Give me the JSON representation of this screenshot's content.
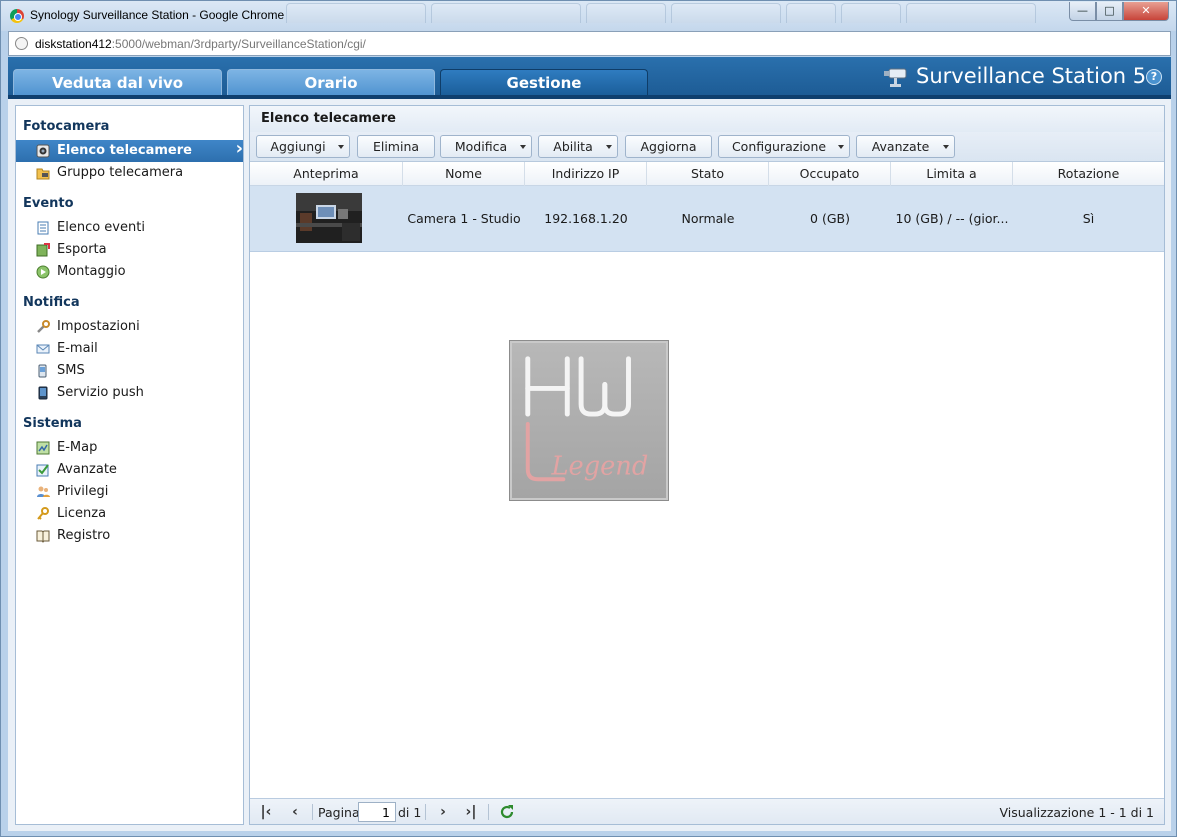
{
  "browser": {
    "window_title": "Synology Surveillance Station - Google Chrome",
    "url_host": "diskstation412",
    "url_path": ":5000/webman/3rdparty/SurveillanceStation/cgi/",
    "controls": {
      "minimize": "—",
      "maximize": "□",
      "close": "✕"
    }
  },
  "app": {
    "brand": "Surveillance Station 5",
    "help": "?",
    "tabs": [
      {
        "label": "Veduta dal vivo",
        "active": false
      },
      {
        "label": "Orario",
        "active": false
      },
      {
        "label": "Gestione",
        "active": true
      }
    ]
  },
  "sidebar": {
    "sections": [
      {
        "title": "Fotocamera",
        "items": [
          {
            "label": "Elenco telecamere",
            "icon": "camera-icon",
            "selected": true
          },
          {
            "label": "Gruppo telecamera",
            "icon": "folder-camera-icon",
            "selected": false
          }
        ]
      },
      {
        "title": "Evento",
        "items": [
          {
            "label": "Elenco eventi",
            "icon": "event-list-icon"
          },
          {
            "label": "Esporta",
            "icon": "export-icon"
          },
          {
            "label": "Montaggio",
            "icon": "montage-icon"
          }
        ]
      },
      {
        "title": "Notifica",
        "items": [
          {
            "label": "Impostazioni",
            "icon": "wrench-icon"
          },
          {
            "label": "E-mail",
            "icon": "envelope-icon"
          },
          {
            "label": "SMS",
            "icon": "sms-icon"
          },
          {
            "label": "Servizio push",
            "icon": "mobile-icon"
          }
        ]
      },
      {
        "title": "Sistema",
        "items": [
          {
            "label": "E-Map",
            "icon": "map-icon"
          },
          {
            "label": "Avanzate",
            "icon": "advanced-icon"
          },
          {
            "label": "Privilegi",
            "icon": "users-icon"
          },
          {
            "label": "Licenza",
            "icon": "key-icon"
          },
          {
            "label": "Registro",
            "icon": "book-icon"
          }
        ]
      }
    ]
  },
  "panel": {
    "title": "Elenco telecamere",
    "toolbar": [
      {
        "label": "Aggiungi",
        "dropdown": true
      },
      {
        "label": "Elimina",
        "dropdown": false
      },
      {
        "label": "Modifica",
        "dropdown": true
      },
      {
        "label": "Abilita",
        "dropdown": true
      },
      {
        "label": "Aggiorna",
        "dropdown": false
      },
      {
        "label": "Configurazione",
        "dropdown": true
      },
      {
        "label": "Avanzate",
        "dropdown": true
      }
    ],
    "columns": [
      "Anteprima",
      "Nome",
      "Indirizzo IP",
      "Stato",
      "Occupato",
      "Limita a",
      "Rotazione"
    ],
    "rows": [
      {
        "name": "Camera 1 - Studio",
        "ip": "192.168.1.20",
        "status": "Normale",
        "used": "0 (GB)",
        "limit": "10 (GB) / -- (gior...",
        "rotation": "Sì"
      }
    ],
    "pager": {
      "page_label": "Pagina",
      "page_value": "1",
      "of_label": "di 1",
      "status": "Visualizzazione 1 - 1 di 1"
    }
  },
  "watermark": {
    "text": "Legend"
  }
}
